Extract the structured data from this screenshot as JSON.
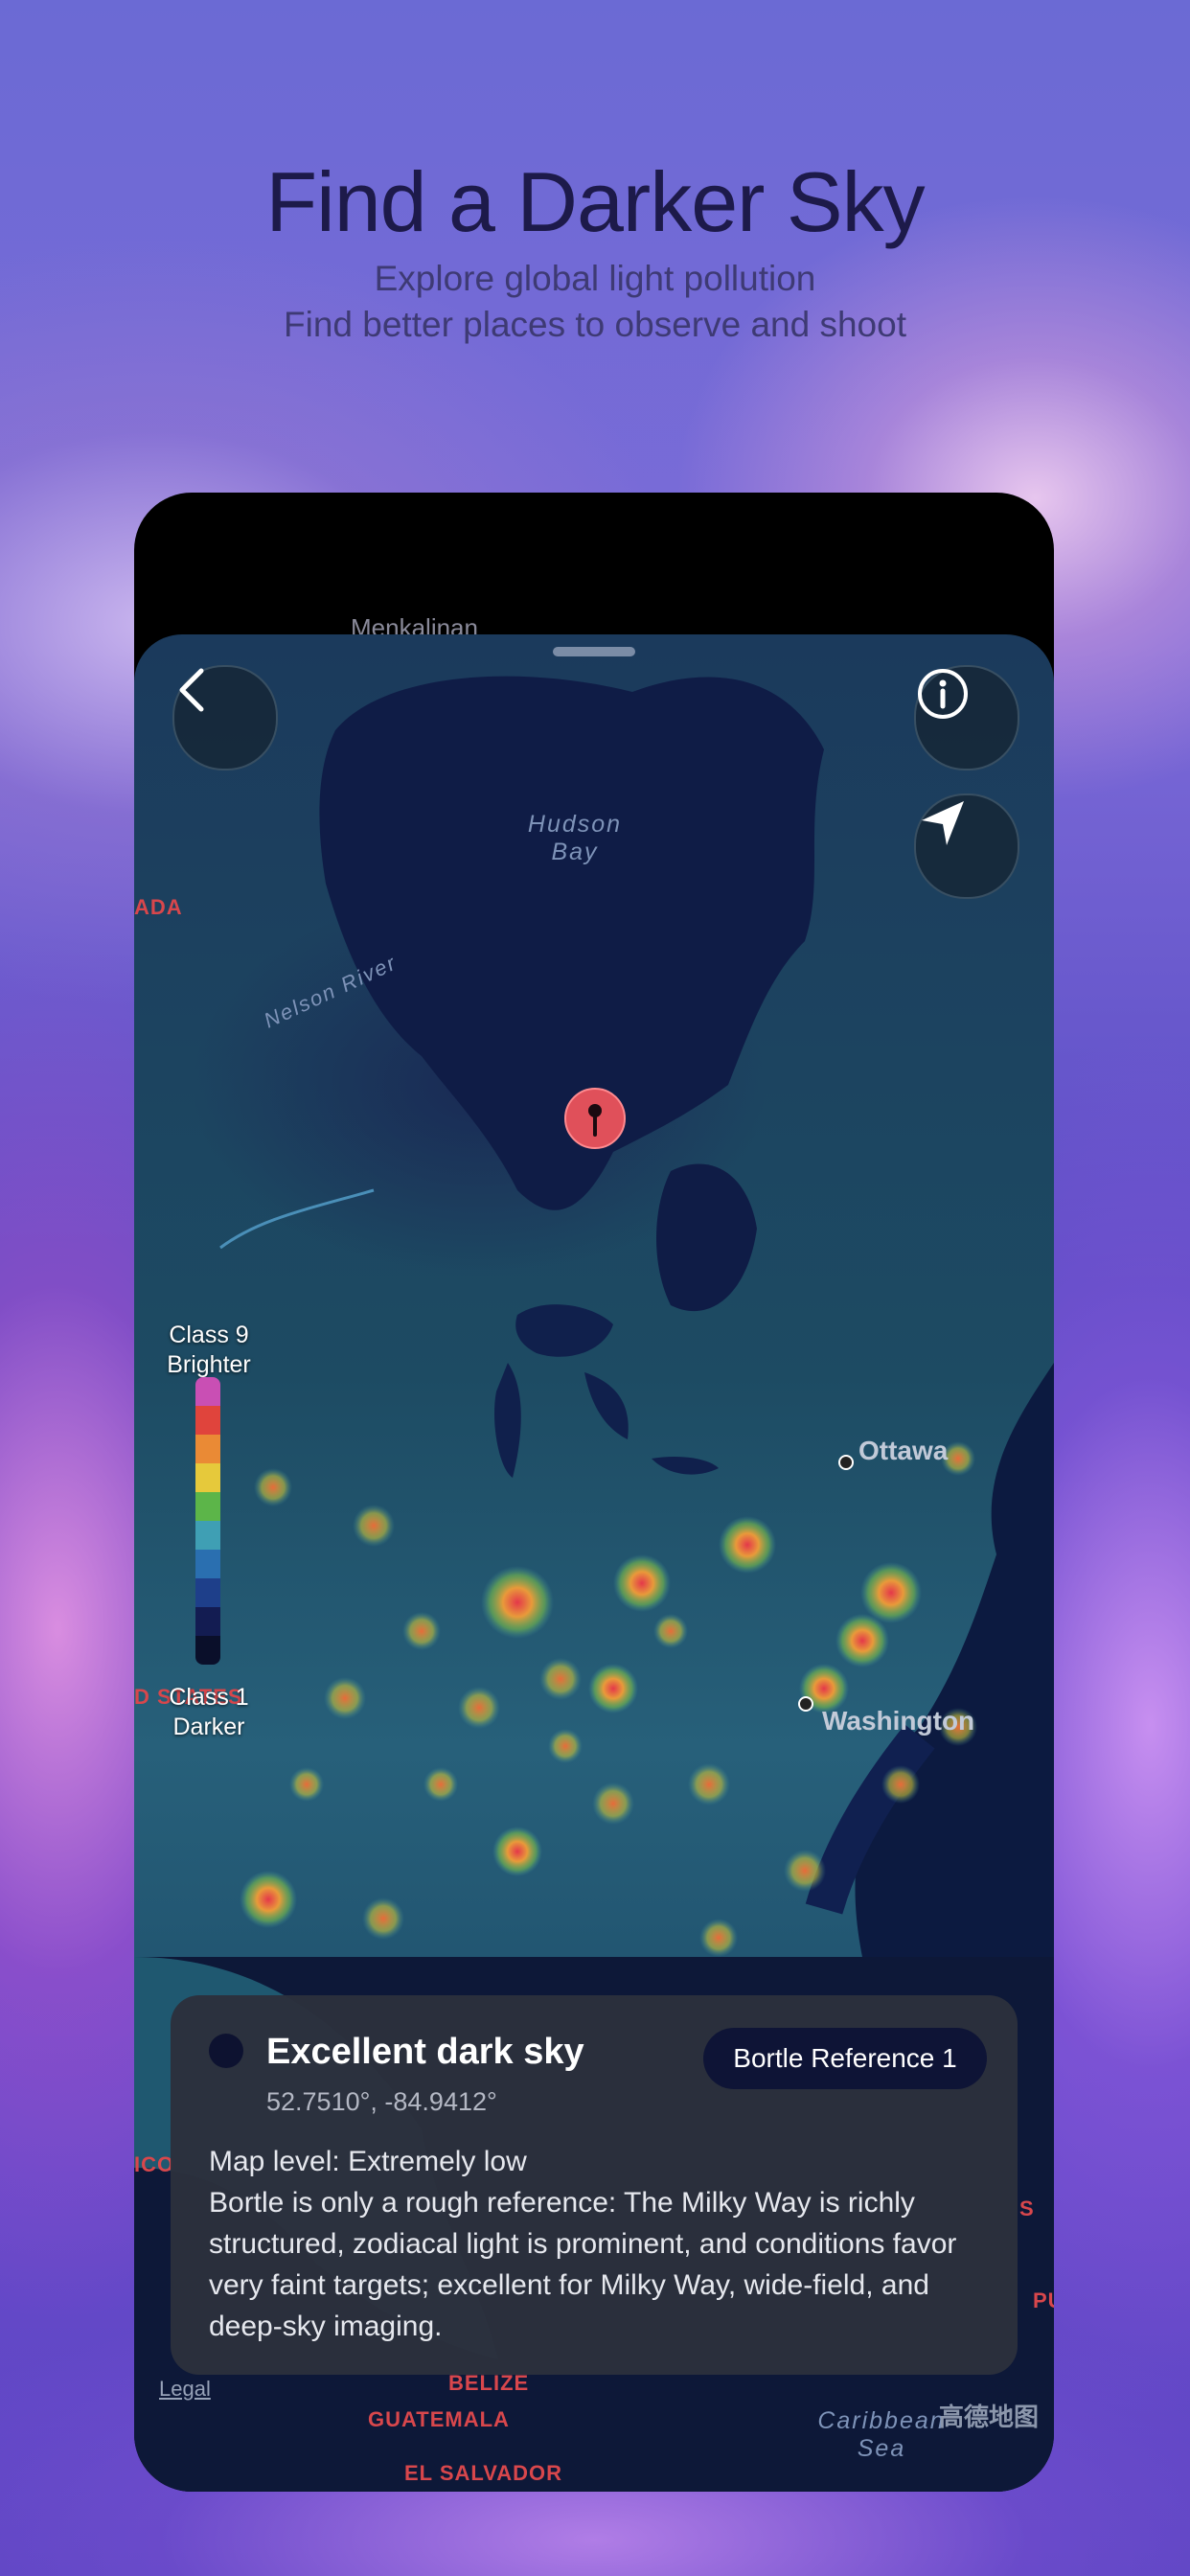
{
  "hero": {
    "title": "Find a Darker Sky",
    "subtitle_line1": "Explore global light pollution",
    "subtitle_line2": "Find better places to observe and shoot"
  },
  "sky": {
    "star_label": "Menkalinan"
  },
  "map": {
    "labels": {
      "hudson_line1": "Hudson",
      "hudson_line2": "Bay",
      "nelson_river": "Nelson River",
      "caribbean_line1": "Caribbean",
      "caribbean_line2": "Sea"
    },
    "countries": {
      "canada": "ADA",
      "united_states": "D STATES",
      "mexico": "ICO",
      "belize": "BELIZE",
      "guatemala": "GUATEMALA",
      "el_salvador": "EL SALVADOR",
      "edge_s": "S",
      "edge_pu": "PU"
    },
    "cities": {
      "ottawa": "Ottawa",
      "washington": "Washington"
    },
    "legal": "Legal",
    "attribution": "高德地图"
  },
  "legend": {
    "top_line1": "Class 9",
    "top_line2": "Brighter",
    "bottom_line1": "Class 1",
    "bottom_line2": "Darker",
    "colors": [
      "#c94fb4",
      "#e0443c",
      "#ea8a35",
      "#e6c93b",
      "#5cb549",
      "#3f9fb4",
      "#2a6fb0",
      "#1e3f8a",
      "#131c52",
      "#0a0f2a"
    ]
  },
  "card": {
    "title": "Excellent dark sky",
    "coords": "52.7510°, -84.9412°",
    "badge": "Bortle Reference 1",
    "map_level": "Map level: Extremely low",
    "description": "Bortle is only a rough reference: The Milky Way is richly structured, zodiacal light is prominent, and conditions favor very faint targets; excellent for Milky Way, wide-field, and deep-sky imaging."
  },
  "colors": {
    "accent_pin": "#e0505a",
    "card_background": "#2c303c",
    "badge_background": "#0e1436"
  }
}
